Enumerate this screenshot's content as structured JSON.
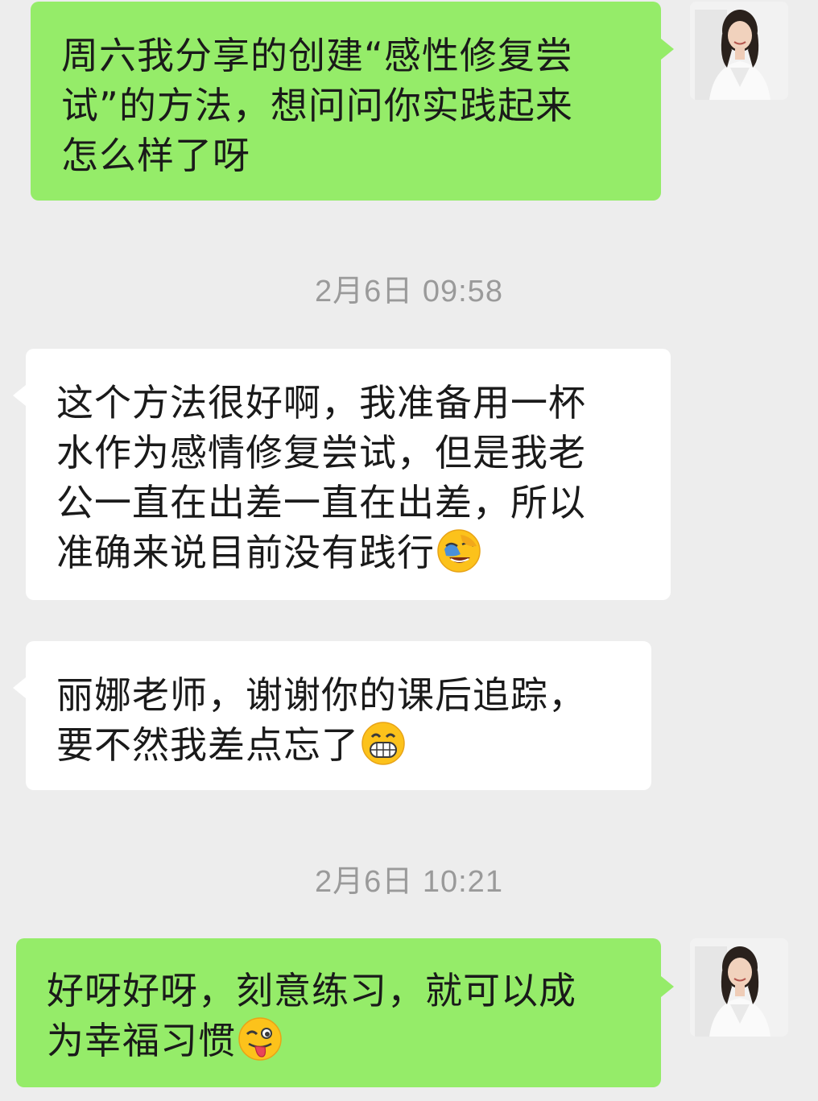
{
  "messages": [
    {
      "direction": "outgoing",
      "lines": [
        "周六我分享的创建“感性修复尝",
        "试”的方法，想问问你实践起来",
        "怎么样了呀"
      ],
      "emoji": ""
    },
    {
      "direction": "incoming",
      "lines": [
        "这个方法很好啊，我准备用一杯",
        "水作为感情修复尝试，但是我老",
        "公一直在出差一直在出差，所以",
        "准确来说目前没有践行"
      ],
      "emoji": "facepalm-laugh-emoji"
    },
    {
      "direction": "incoming",
      "lines": [
        "丽娜老师，谢谢你的课后追踪，",
        "要不然我差点忘了"
      ],
      "emoji": "grin-emoji"
    },
    {
      "direction": "outgoing",
      "lines": [
        "好呀好呀，刻意练习，就可以成",
        "为幸福习惯"
      ],
      "emoji": "wink-tongue-emoji"
    }
  ],
  "timestamps": [
    "2月6日 09:58",
    "2月6日 10:21"
  ],
  "colors": {
    "background": "#ededed",
    "outgoing_bubble": "#95ec69",
    "incoming_bubble": "#ffffff",
    "timestamp_text": "#9a9a9a",
    "message_text": "#1a1a1a"
  }
}
